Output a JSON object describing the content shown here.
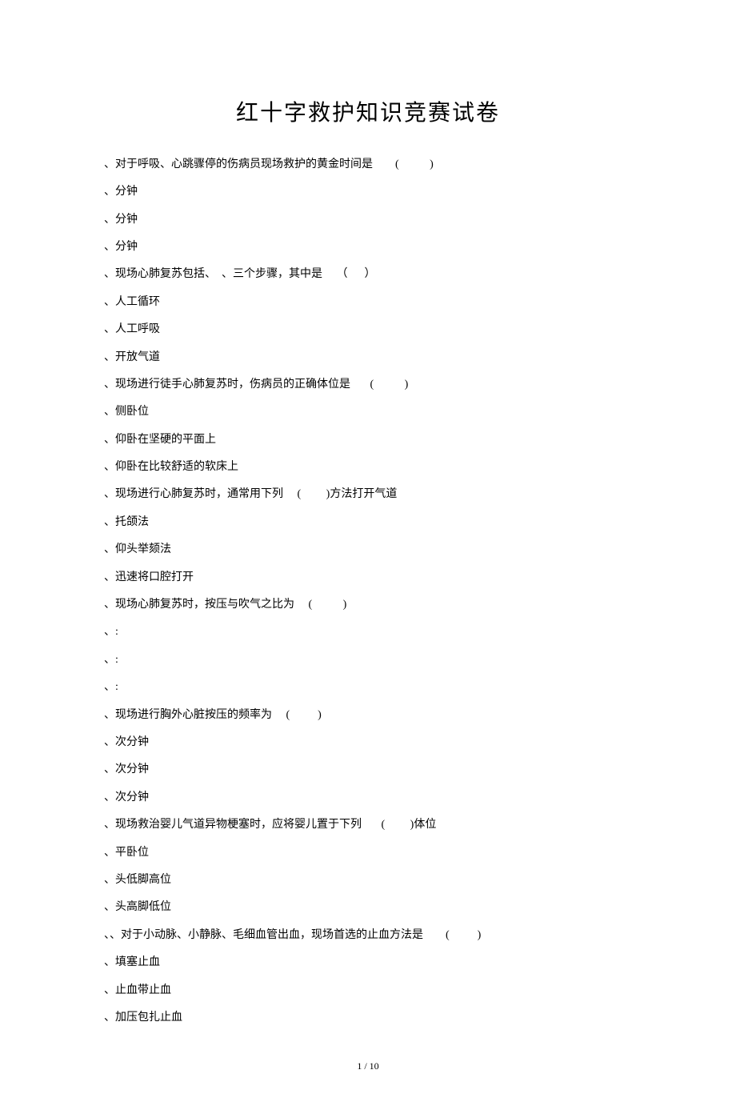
{
  "title": "红十字救护知识竞赛试卷",
  "lines": [
    "、对于呼吸、心跳骤停的伤病员现场救护的黄金时间是        (           )",
    "、分钟",
    "、分钟",
    "、分钟",
    "、现场心肺复苏包括、  、三个步骤，其中是     （      ）",
    "、人工循环",
    "、人工呼吸",
    "、开放气道",
    "、现场进行徒手心肺复苏时，伤病员的正确体位是       (           )",
    "、侧卧位",
    "、仰卧在坚硬的平面上",
    "、仰卧在比较舒适的软床上",
    "、现场进行心肺复苏时，通常用下列     (         )方法打开气道",
    "、托颌法",
    "、仰头举颏法",
    "、迅速将口腔打开",
    "、现场心肺复苏时，按压与吹气之比为     (           )",
    "、:",
    "、:",
    "、:",
    "、现场进行胸外心脏按压的频率为     (          )",
    "、次分钟",
    "、次分钟",
    "、次分钟",
    "、现场救治婴儿气道异物梗塞时，应将婴儿置于下列       (         )体位",
    "、平卧位",
    "、头低脚高位",
    "、头高脚低位",
    "、、对于小动脉、小静脉、毛细血管出血，现场首选的止血方法是        (          )",
    "、填塞止血",
    "、止血带止血",
    "、加压包扎止血"
  ],
  "page_number": "1 / 10"
}
